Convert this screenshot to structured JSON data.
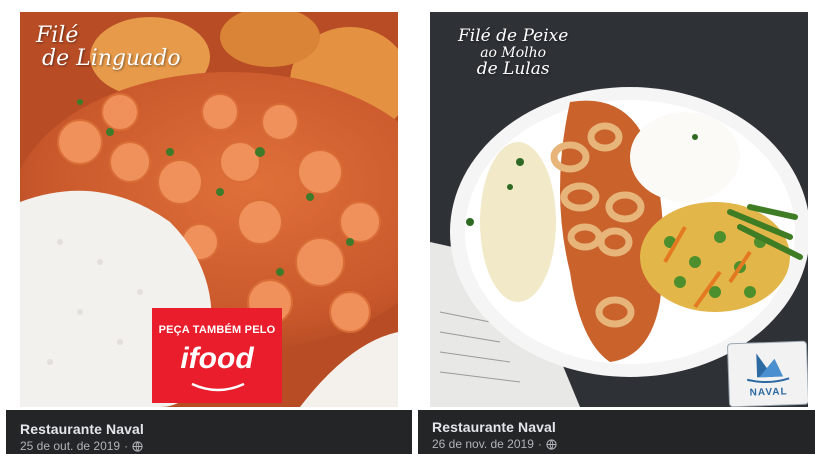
{
  "posts": [
    {
      "page_name": "Restaurante Naval",
      "date": "25 de out. de 2019",
      "separator": "·",
      "visibility_icon": "globe-icon",
      "image": {
        "dish_title_line1": "Filé",
        "dish_title_line2": "de Linguado",
        "promo_line": "PEÇA TAMBÉM PELO",
        "brand": "ifood"
      }
    },
    {
      "page_name": "Restaurante Naval",
      "date": "26 de nov. de 2019",
      "separator": "·",
      "visibility_icon": "globe-icon",
      "image": {
        "dish_title_line1": "Filé de Peixe",
        "dish_title_line2": "ao Molho",
        "dish_title_line3": "de Lulas",
        "logo_text": "NAVAL"
      }
    }
  ],
  "colors": {
    "footer_bg": "#242526",
    "page_name": "#e4e6eb",
    "meta_text": "#b0b3b8",
    "ifood_red": "#ea1d2c"
  }
}
